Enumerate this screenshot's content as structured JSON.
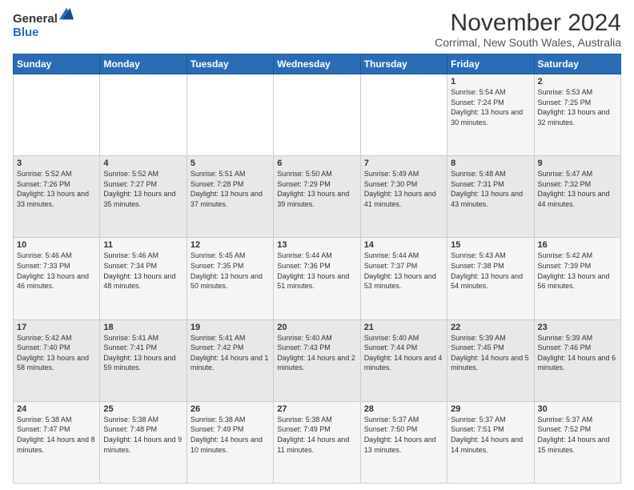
{
  "logo": {
    "general": "General",
    "blue": "Blue"
  },
  "header": {
    "month_year": "November 2024",
    "location": "Corrimal, New South Wales, Australia"
  },
  "days_of_week": [
    "Sunday",
    "Monday",
    "Tuesday",
    "Wednesday",
    "Thursday",
    "Friday",
    "Saturday"
  ],
  "weeks": [
    [
      {
        "day": "",
        "info": ""
      },
      {
        "day": "",
        "info": ""
      },
      {
        "day": "",
        "info": ""
      },
      {
        "day": "",
        "info": ""
      },
      {
        "day": "",
        "info": ""
      },
      {
        "day": "1",
        "info": "Sunrise: 5:54 AM\nSunset: 7:24 PM\nDaylight: 13 hours and 30 minutes."
      },
      {
        "day": "2",
        "info": "Sunrise: 5:53 AM\nSunset: 7:25 PM\nDaylight: 13 hours and 32 minutes."
      }
    ],
    [
      {
        "day": "3",
        "info": "Sunrise: 5:52 AM\nSunset: 7:26 PM\nDaylight: 13 hours and 33 minutes."
      },
      {
        "day": "4",
        "info": "Sunrise: 5:52 AM\nSunset: 7:27 PM\nDaylight: 13 hours and 35 minutes."
      },
      {
        "day": "5",
        "info": "Sunrise: 5:51 AM\nSunset: 7:28 PM\nDaylight: 13 hours and 37 minutes."
      },
      {
        "day": "6",
        "info": "Sunrise: 5:50 AM\nSunset: 7:29 PM\nDaylight: 13 hours and 39 minutes."
      },
      {
        "day": "7",
        "info": "Sunrise: 5:49 AM\nSunset: 7:30 PM\nDaylight: 13 hours and 41 minutes."
      },
      {
        "day": "8",
        "info": "Sunrise: 5:48 AM\nSunset: 7:31 PM\nDaylight: 13 hours and 43 minutes."
      },
      {
        "day": "9",
        "info": "Sunrise: 5:47 AM\nSunset: 7:32 PM\nDaylight: 13 hours and 44 minutes."
      }
    ],
    [
      {
        "day": "10",
        "info": "Sunrise: 5:46 AM\nSunset: 7:33 PM\nDaylight: 13 hours and 46 minutes."
      },
      {
        "day": "11",
        "info": "Sunrise: 5:46 AM\nSunset: 7:34 PM\nDaylight: 13 hours and 48 minutes."
      },
      {
        "day": "12",
        "info": "Sunrise: 5:45 AM\nSunset: 7:35 PM\nDaylight: 13 hours and 50 minutes."
      },
      {
        "day": "13",
        "info": "Sunrise: 5:44 AM\nSunset: 7:36 PM\nDaylight: 13 hours and 51 minutes."
      },
      {
        "day": "14",
        "info": "Sunrise: 5:44 AM\nSunset: 7:37 PM\nDaylight: 13 hours and 53 minutes."
      },
      {
        "day": "15",
        "info": "Sunrise: 5:43 AM\nSunset: 7:38 PM\nDaylight: 13 hours and 54 minutes."
      },
      {
        "day": "16",
        "info": "Sunrise: 5:42 AM\nSunset: 7:39 PM\nDaylight: 13 hours and 56 minutes."
      }
    ],
    [
      {
        "day": "17",
        "info": "Sunrise: 5:42 AM\nSunset: 7:40 PM\nDaylight: 13 hours and 58 minutes."
      },
      {
        "day": "18",
        "info": "Sunrise: 5:41 AM\nSunset: 7:41 PM\nDaylight: 13 hours and 59 minutes."
      },
      {
        "day": "19",
        "info": "Sunrise: 5:41 AM\nSunset: 7:42 PM\nDaylight: 14 hours and 1 minute."
      },
      {
        "day": "20",
        "info": "Sunrise: 5:40 AM\nSunset: 7:43 PM\nDaylight: 14 hours and 2 minutes."
      },
      {
        "day": "21",
        "info": "Sunrise: 5:40 AM\nSunset: 7:44 PM\nDaylight: 14 hours and 4 minutes."
      },
      {
        "day": "22",
        "info": "Sunrise: 5:39 AM\nSunset: 7:45 PM\nDaylight: 14 hours and 5 minutes."
      },
      {
        "day": "23",
        "info": "Sunrise: 5:39 AM\nSunset: 7:46 PM\nDaylight: 14 hours and 6 minutes."
      }
    ],
    [
      {
        "day": "24",
        "info": "Sunrise: 5:38 AM\nSunset: 7:47 PM\nDaylight: 14 hours and 8 minutes."
      },
      {
        "day": "25",
        "info": "Sunrise: 5:38 AM\nSunset: 7:48 PM\nDaylight: 14 hours and 9 minutes."
      },
      {
        "day": "26",
        "info": "Sunrise: 5:38 AM\nSunset: 7:49 PM\nDaylight: 14 hours and 10 minutes."
      },
      {
        "day": "27",
        "info": "Sunrise: 5:38 AM\nSunset: 7:49 PM\nDaylight: 14 hours and 11 minutes."
      },
      {
        "day": "28",
        "info": "Sunrise: 5:37 AM\nSunset: 7:50 PM\nDaylight: 14 hours and 13 minutes."
      },
      {
        "day": "29",
        "info": "Sunrise: 5:37 AM\nSunset: 7:51 PM\nDaylight: 14 hours and 14 minutes."
      },
      {
        "day": "30",
        "info": "Sunrise: 5:37 AM\nSunset: 7:52 PM\nDaylight: 14 hours and 15 minutes."
      }
    ]
  ]
}
